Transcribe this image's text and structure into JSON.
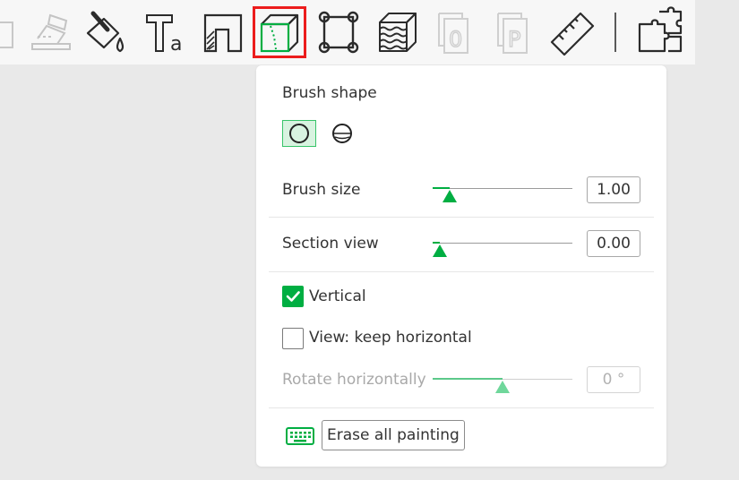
{
  "toolbar": {
    "icons": [
      {
        "name": "partial-left-icon",
        "selected": false,
        "disabled": true
      },
      {
        "name": "auto-orient-icon",
        "selected": false,
        "disabled": true
      },
      {
        "name": "paint-bucket-icon",
        "selected": false,
        "disabled": false
      },
      {
        "name": "text-tool-icon",
        "selected": false,
        "disabled": false
      },
      {
        "name": "fill-shape-icon",
        "selected": false,
        "disabled": false
      },
      {
        "name": "seam-painting-icon",
        "selected": true,
        "disabled": false
      },
      {
        "name": "support-vertices-icon",
        "selected": false,
        "disabled": false
      },
      {
        "name": "fuzzy-skin-icon",
        "selected": false,
        "disabled": false
      },
      {
        "name": "plate-0-icon",
        "selected": false,
        "disabled": true
      },
      {
        "name": "plate-p-icon",
        "selected": false,
        "disabled": true
      },
      {
        "name": "ruler-icon",
        "selected": false,
        "disabled": false
      },
      {
        "name": "assembly-puzzle-icon",
        "selected": false,
        "disabled": false
      }
    ],
    "text_icon_letter": "T",
    "text_icon_small": "a",
    "plate_zero_label": "0",
    "plate_p_label": "P"
  },
  "panel": {
    "brush_shape_label": "Brush shape",
    "brush_shapes": [
      {
        "name": "circle",
        "active": true
      },
      {
        "name": "sphere",
        "active": false
      }
    ],
    "brush_size": {
      "label": "Brush size",
      "value": "1.00",
      "slider_fraction": 0.12
    },
    "section_view": {
      "label": "Section view",
      "value": "0.00",
      "slider_fraction": 0.05
    },
    "vertical": {
      "label": "Vertical",
      "checked": true
    },
    "keep_horizontal": {
      "label": "View: keep horizontal",
      "checked": false
    },
    "rotate_horizontally": {
      "label": "Rotate horizontally",
      "value": "0 °",
      "slider_fraction": 0.5,
      "disabled": true
    },
    "erase_all": {
      "label": "Erase all painting"
    }
  },
  "colors": {
    "accent": "#00ae42",
    "selected_outline": "#ec1c1c"
  }
}
